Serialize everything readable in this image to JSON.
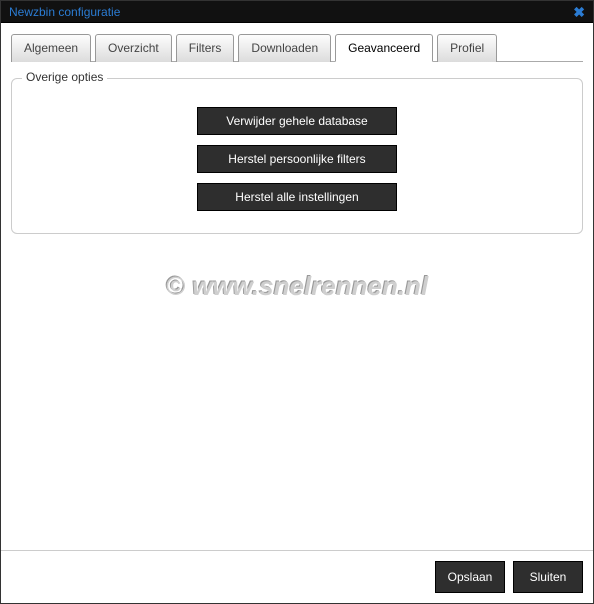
{
  "window": {
    "title": "Newzbin configuratie"
  },
  "tabs": {
    "algemeen": "Algemeen",
    "overzicht": "Overzicht",
    "filters": "Filters",
    "downloaden": "Downloaden",
    "geavanceerd": "Geavanceerd",
    "profiel": "Profiel",
    "active": "geavanceerd"
  },
  "group": {
    "legend": "Overige opties",
    "buttons": {
      "delete_db": "Verwijder gehele database",
      "reset_filters": "Herstel persoonlijke filters",
      "reset_settings": "Herstel alle instellingen"
    }
  },
  "watermark": "© www.snelrennen.nl",
  "footer": {
    "save": "Opslaan",
    "close": "Sluiten"
  }
}
